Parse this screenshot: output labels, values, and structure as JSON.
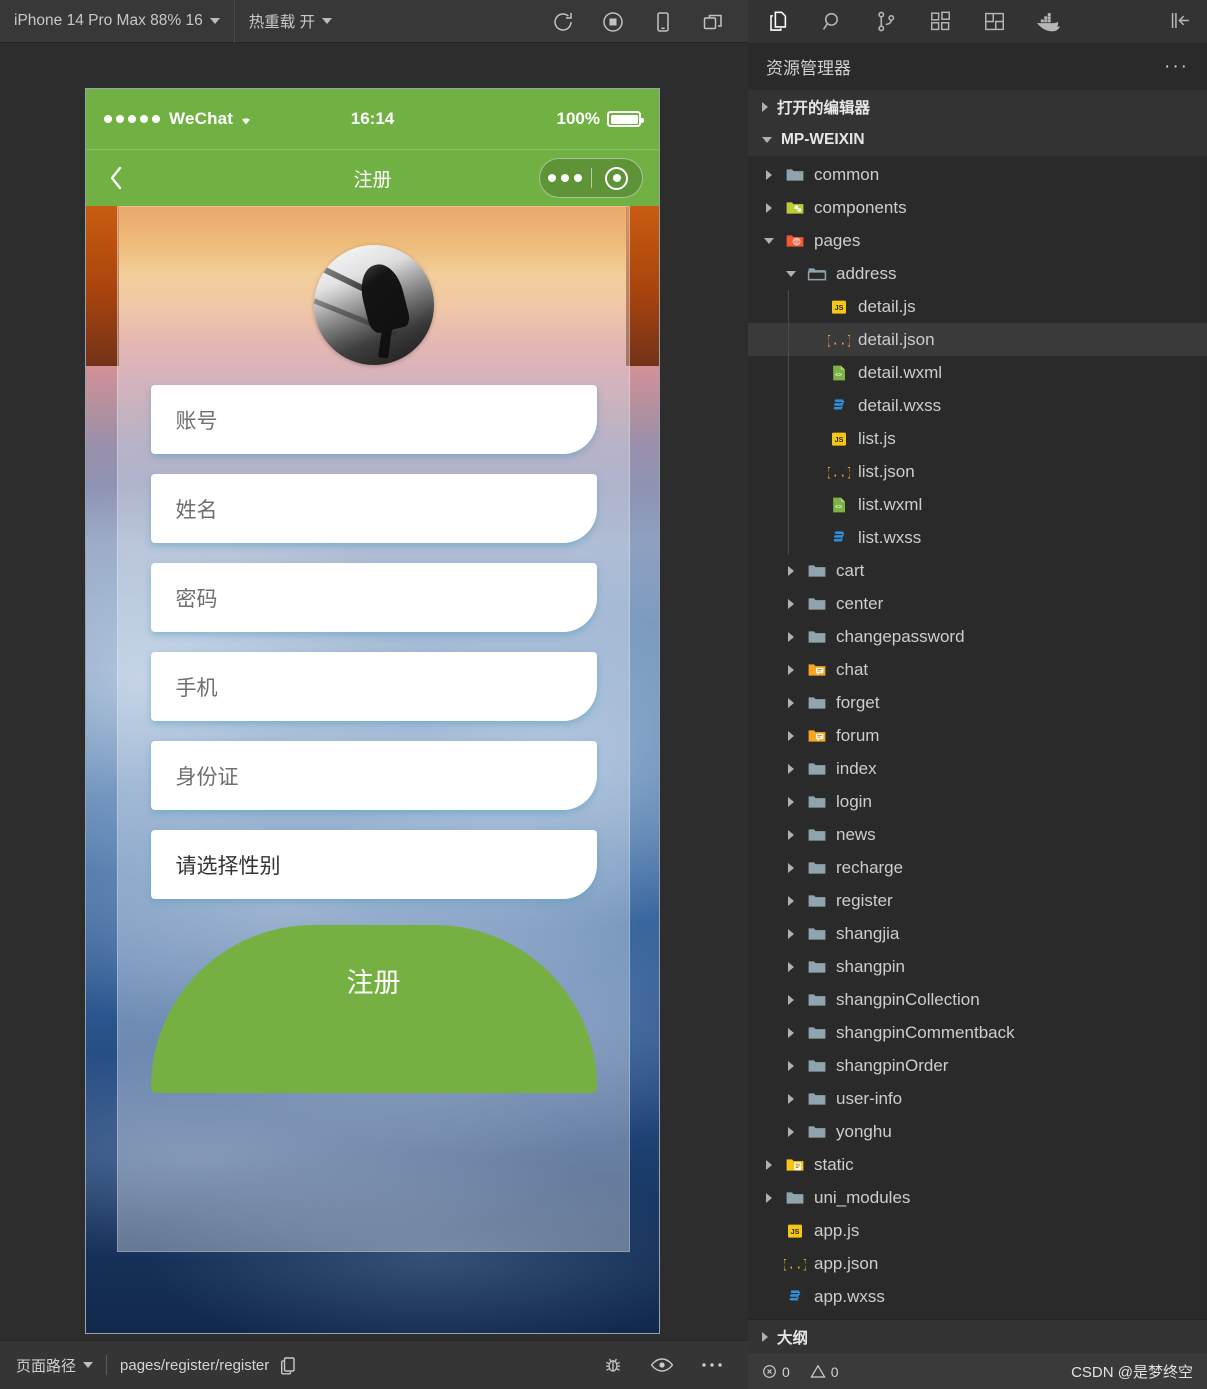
{
  "simulator": {
    "toolbar": {
      "device_label": "iPhone 14 Pro Max 88% 16",
      "hotreload_label": "热重载 开",
      "icons": [
        "refresh-icon",
        "stop-icon",
        "device-icon",
        "multiscreen-icon"
      ]
    },
    "phone": {
      "status": {
        "carrier": "WeChat",
        "time": "16:14",
        "battery": "100%"
      },
      "nav": {
        "title": "注册",
        "back_icon": "chevron-left-icon",
        "capsule_more_icon": "more-dots-icon",
        "capsule_target_icon": "target-icon"
      },
      "form": {
        "fields": [
          {
            "placeholder": "账号",
            "value": "",
            "name": "account-field"
          },
          {
            "placeholder": "姓名",
            "value": "",
            "name": "name-field"
          },
          {
            "placeholder": "密码",
            "value": "",
            "name": "password-field"
          },
          {
            "placeholder": "手机",
            "value": "",
            "name": "phone-field"
          },
          {
            "placeholder": "身份证",
            "value": "",
            "name": "idcard-field"
          }
        ],
        "gender_select": "请选择性别",
        "submit_label": "注册"
      },
      "colors": {
        "brand_green": "#71b043",
        "button_green": "#76b043"
      }
    },
    "footer": {
      "path_label": "页面路径",
      "path_value": "pages/register/register",
      "copy_icon": "copy-icon",
      "icons": [
        "bug-icon",
        "eye-icon",
        "more-dots-icon"
      ]
    }
  },
  "ide": {
    "activity_icons": [
      "files-icon",
      "search-icon",
      "source-control-icon",
      "extensions-icon",
      "layout-icon",
      "docker-icon"
    ],
    "collapse_icon": "collapse-sidebar-icon",
    "explorer_title": "资源管理器",
    "explorer_more": "···",
    "sections": {
      "open_editors": "打开的编辑器",
      "workspace": "MP-WEIXIN",
      "outline": "大纲"
    },
    "tree": [
      {
        "label": "common",
        "kind": "folder",
        "indent": 1,
        "twisty": "right"
      },
      {
        "label": "components",
        "kind": "folder-comp",
        "indent": 1,
        "twisty": "right"
      },
      {
        "label": "pages",
        "kind": "folder-pages",
        "indent": 1,
        "twisty": "down"
      },
      {
        "label": "address",
        "kind": "folder-open",
        "indent": 2,
        "twisty": "down"
      },
      {
        "label": "detail.js",
        "kind": "js",
        "indent": 3,
        "twisty": "none"
      },
      {
        "label": "detail.json",
        "kind": "json",
        "indent": 3,
        "twisty": "none",
        "active": true
      },
      {
        "label": "detail.wxml",
        "kind": "wxml",
        "indent": 3,
        "twisty": "none"
      },
      {
        "label": "detail.wxss",
        "kind": "css",
        "indent": 3,
        "twisty": "none"
      },
      {
        "label": "list.js",
        "kind": "js",
        "indent": 3,
        "twisty": "none"
      },
      {
        "label": "list.json",
        "kind": "json",
        "indent": 3,
        "twisty": "none"
      },
      {
        "label": "list.wxml",
        "kind": "wxml",
        "indent": 3,
        "twisty": "none"
      },
      {
        "label": "list.wxss",
        "kind": "css",
        "indent": 3,
        "twisty": "none"
      },
      {
        "label": "cart",
        "kind": "folder",
        "indent": 2,
        "twisty": "right"
      },
      {
        "label": "center",
        "kind": "folder",
        "indent": 2,
        "twisty": "right"
      },
      {
        "label": "changepassword",
        "kind": "folder",
        "indent": 2,
        "twisty": "right"
      },
      {
        "label": "chat",
        "kind": "folder-chat",
        "indent": 2,
        "twisty": "right"
      },
      {
        "label": "forget",
        "kind": "folder",
        "indent": 2,
        "twisty": "right"
      },
      {
        "label": "forum",
        "kind": "folder-chat",
        "indent": 2,
        "twisty": "right"
      },
      {
        "label": "index",
        "kind": "folder",
        "indent": 2,
        "twisty": "right"
      },
      {
        "label": "login",
        "kind": "folder",
        "indent": 2,
        "twisty": "right"
      },
      {
        "label": "news",
        "kind": "folder",
        "indent": 2,
        "twisty": "right"
      },
      {
        "label": "recharge",
        "kind": "folder",
        "indent": 2,
        "twisty": "right"
      },
      {
        "label": "register",
        "kind": "folder",
        "indent": 2,
        "twisty": "right"
      },
      {
        "label": "shangjia",
        "kind": "folder",
        "indent": 2,
        "twisty": "right"
      },
      {
        "label": "shangpin",
        "kind": "folder",
        "indent": 2,
        "twisty": "right"
      },
      {
        "label": "shangpinCollection",
        "kind": "folder",
        "indent": 2,
        "twisty": "right"
      },
      {
        "label": "shangpinCommentback",
        "kind": "folder",
        "indent": 2,
        "twisty": "right"
      },
      {
        "label": "shangpinOrder",
        "kind": "folder",
        "indent": 2,
        "twisty": "right"
      },
      {
        "label": "user-info",
        "kind": "folder",
        "indent": 2,
        "twisty": "right"
      },
      {
        "label": "yonghu",
        "kind": "folder",
        "indent": 2,
        "twisty": "right"
      },
      {
        "label": "static",
        "kind": "folder-static",
        "indent": 1,
        "twisty": "right"
      },
      {
        "label": "uni_modules",
        "kind": "folder",
        "indent": 1,
        "twisty": "right"
      },
      {
        "label": "app.js",
        "kind": "js",
        "indent": 1,
        "twisty": "none"
      },
      {
        "label": "app.json",
        "kind": "json",
        "indent": 1,
        "twisty": "none"
      },
      {
        "label": "app.wxss",
        "kind": "css",
        "indent": 1,
        "twisty": "none"
      }
    ],
    "status": {
      "error_icon": "error-circle-icon",
      "errors": "0",
      "warning_icon": "warning-triangle-icon",
      "warnings": "0",
      "watermark": "CSDN @是梦终空"
    }
  }
}
